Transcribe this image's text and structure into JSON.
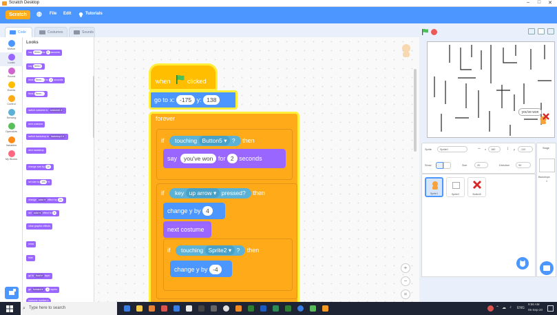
{
  "window": {
    "title": "Scratch Desktop",
    "min": "–",
    "max": "□",
    "close": "✕"
  },
  "menu": {
    "logo": "Scratch",
    "globe": "◍",
    "file": "File",
    "edit": "Edit",
    "tutorials": "Tutorials"
  },
  "tabs": {
    "code": "Code",
    "costumes": "Costumes",
    "sounds": "Sounds"
  },
  "categories": [
    {
      "label": "Motion",
      "color": "#4c97ff"
    },
    {
      "label": "Looks",
      "color": "#9966ff"
    },
    {
      "label": "Sound",
      "color": "#cf63cf"
    },
    {
      "label": "Events",
      "color": "#ffbf00"
    },
    {
      "label": "Control",
      "color": "#ffab19"
    },
    {
      "label": "Sensing",
      "color": "#5cb1d6"
    },
    {
      "label": "Operators",
      "color": "#59c059"
    },
    {
      "label": "Variables",
      "color": "#ff8c1a"
    },
    {
      "label": "My Blocks",
      "color": "#ff6680"
    }
  ],
  "palette": {
    "heading": "Looks",
    "say_for": {
      "a": "say",
      "v1": "Hello!",
      "b": "for",
      "v2": "2",
      "c": "seconds"
    },
    "say": {
      "a": "say",
      "v1": "Hello!"
    },
    "think_for": {
      "a": "think",
      "v1": "Hmm...",
      "b": "for",
      "v2": "2",
      "c": "seconds"
    },
    "think": {
      "a": "think",
      "v1": "Hmm..."
    },
    "switch_costume": {
      "a": "switch costume to",
      "v1": "costume1 ▾"
    },
    "next_costume": "next costume",
    "switch_backdrop": {
      "a": "switch backdrop to",
      "v1": "backdrop1 ▾"
    },
    "next_backdrop": "next backdrop",
    "change_size": {
      "a": "change size by",
      "v1": "10"
    },
    "set_size": {
      "a": "set size to",
      "v1": "100",
      "b": "%"
    },
    "change_effect": {
      "a": "change",
      "v1": "color ▾",
      "b": "effect by",
      "v2": "25"
    },
    "set_effect": {
      "a": "set",
      "v1": "color ▾",
      "b": "effect to",
      "v2": "0"
    },
    "clear_effects": "clear graphic effects",
    "show": "show",
    "hide": "hide",
    "go_to_layer": {
      "a": "go to",
      "v1": "front ▾",
      "b": "layer"
    },
    "go_layers": {
      "a": "go",
      "v1": "forward ▾",
      "v2": "1",
      "b": "layers"
    },
    "costume_number": {
      "v1": "costume",
      "v2": "number ▾"
    }
  },
  "script": {
    "when": "when",
    "clicked": "clicked",
    "goto_a": "go to x:",
    "goto_x": "-175",
    "goto_b": "y:",
    "goto_y": "138",
    "forever": "forever",
    "if1": "if",
    "touching1": "touching",
    "target1": "Button5 ▾",
    "q1": "?",
    "then1": "then",
    "say_a": "say",
    "say_msg": "you've won",
    "say_b": "for",
    "say_secs": "2",
    "say_c": "seconds",
    "if2": "if",
    "key": "key",
    "key_name": "up arrow ▾",
    "pressed": "pressed?",
    "then2": "then",
    "change_a": "change y by",
    "change_v": "4",
    "next_costume": "next costume",
    "if3": "if",
    "touching3": "touching",
    "target3": "Sprite2 ▾",
    "q3": "?",
    "then3": "then",
    "change2_a": "change y by",
    "change2_v": "-4"
  },
  "zoom": {
    "in": "+",
    "out": "−",
    "reset": "="
  },
  "stage": {
    "bubble": "you've won"
  },
  "sprite_info": {
    "sprite_label": "Sprite",
    "sprite_name": "Sprite1",
    "x_label": "x",
    "x_value": "180",
    "y_label": "y",
    "y_value": "-110",
    "show_label": "Show",
    "size_label": "Size",
    "size_value": "20",
    "direction_label": "Direction",
    "direction_value": "90"
  },
  "sprites": [
    {
      "name": "Sprite1"
    },
    {
      "name": "Sprite2"
    },
    {
      "name": "Button5"
    }
  ],
  "stage_panel": {
    "label": "Stage",
    "backdrops_label": "Backdrops",
    "backdrops_count": "1"
  },
  "taskbar": {
    "search_placeholder": "Type here to search",
    "lang": "ENG",
    "time": "9:56 AM",
    "date": "05-Sep-20"
  }
}
